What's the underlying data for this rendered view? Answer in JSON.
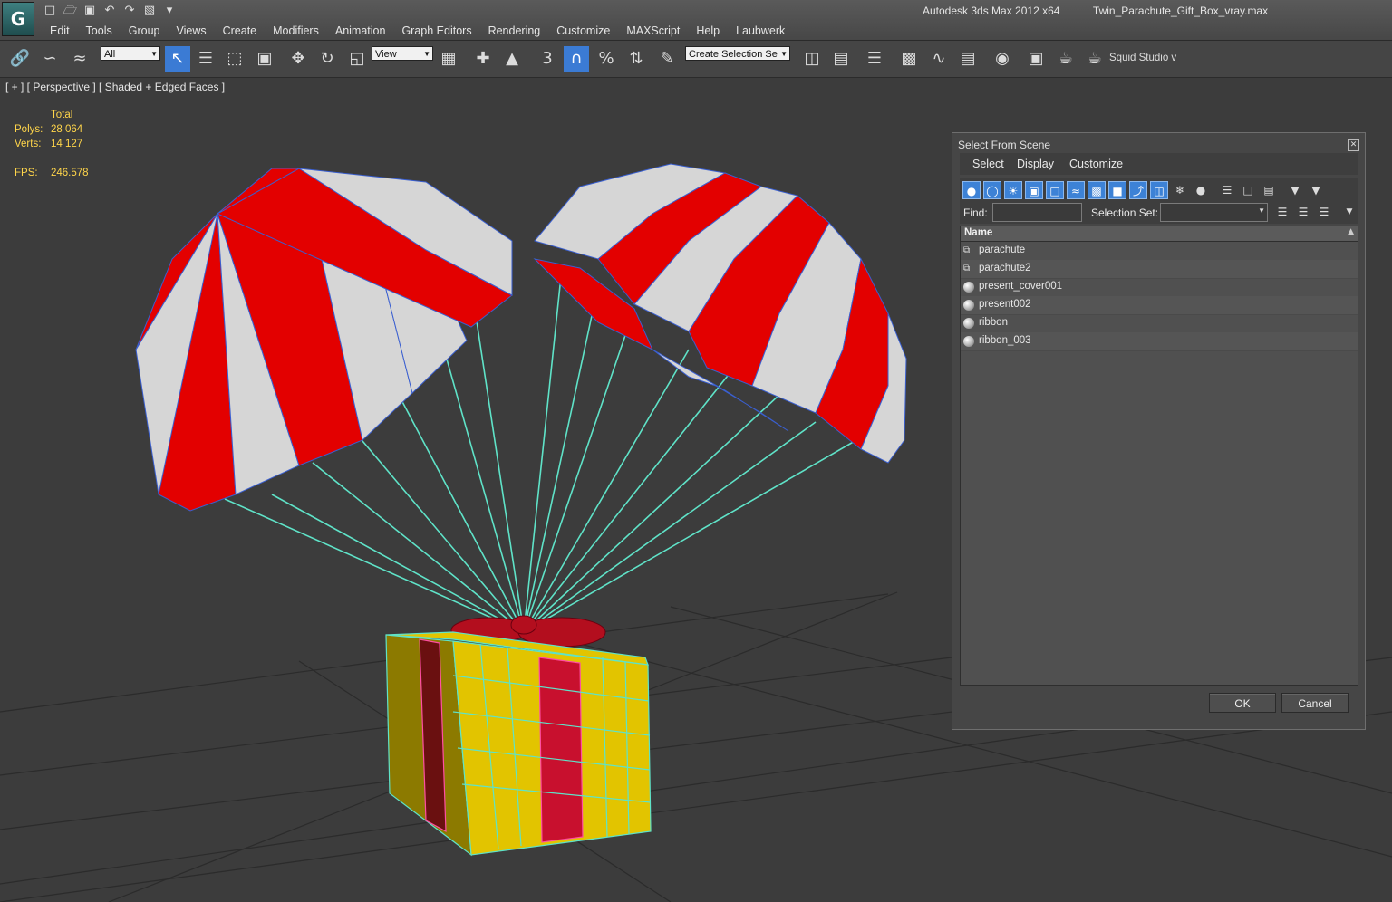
{
  "app": {
    "title": "Autodesk 3ds Max  2012 x64",
    "file_name": "Twin_Parachute_Gift_Box_vray.max",
    "logo_icon": "3dsmax-logo-icon"
  },
  "menu": [
    "Edit",
    "Tools",
    "Group",
    "Views",
    "Create",
    "Modifiers",
    "Animation",
    "Graph Editors",
    "Rendering",
    "Customize",
    "MAXScript",
    "Help",
    "Laubwerk"
  ],
  "toolbar": {
    "selection_filter": "All",
    "reference_coord": "View",
    "named_selection_set": "Create Selection Se",
    "snap_label": "3",
    "squid_label": "Squid Studio v"
  },
  "viewport": {
    "label": "[ + ] [ Perspective ] [ Shaded + Edged Faces ]",
    "stats": {
      "header": "Total",
      "polys_label": "Polys:",
      "polys_value": "28 064",
      "verts_label": "Verts:",
      "verts_value": "14 127",
      "fps_label": "FPS:",
      "fps_value": "246.578"
    },
    "colors": {
      "canopy_red": "#e30000",
      "canopy_white": "#d6d6d6",
      "wire_blue": "#3a5fd0",
      "cords": "#5fe3c8",
      "box_yellow": "#e2c400",
      "box_wire": "#5fe3c8",
      "ribbon": "#c8102e",
      "grid": "#2b2b2b",
      "background": "#3c3c3c"
    }
  },
  "dialog": {
    "title": "Select From Scene",
    "menus": [
      "Select",
      "Display",
      "Customize"
    ],
    "find_label": "Find:",
    "selection_set_label": "Selection Set:",
    "column_name": "Name",
    "rows": [
      {
        "name": "parachute",
        "icon": "group-icon"
      },
      {
        "name": "parachute2",
        "icon": "group-icon"
      },
      {
        "name": "present_cover001",
        "icon": "geometry-sphere-icon"
      },
      {
        "name": "present002",
        "icon": "geometry-sphere-icon"
      },
      {
        "name": "ribbon",
        "icon": "geometry-sphere-icon"
      },
      {
        "name": "ribbon_003",
        "icon": "geometry-sphere-icon"
      }
    ],
    "ok_label": "OK",
    "cancel_label": "Cancel"
  }
}
